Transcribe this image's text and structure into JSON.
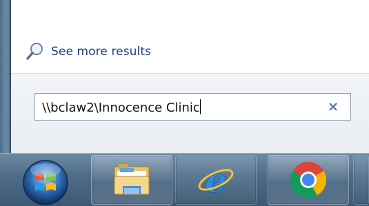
{
  "start_menu": {
    "see_more_results": "See more results",
    "search_value": "\\\\bclaw2\\Innocence Clinic",
    "clear_icon": "close-icon",
    "see_more_icon": "search-icon"
  },
  "taskbar": {
    "items": [
      {
        "icon": "windows-start-orb-icon"
      },
      {
        "icon": "windows-explorer-icon"
      },
      {
        "icon": "internet-explorer-icon"
      },
      {
        "icon": "chrome-icon"
      }
    ]
  },
  "colors": {
    "link_text": "#1c3e86",
    "taskbar": "#4f6d89"
  }
}
